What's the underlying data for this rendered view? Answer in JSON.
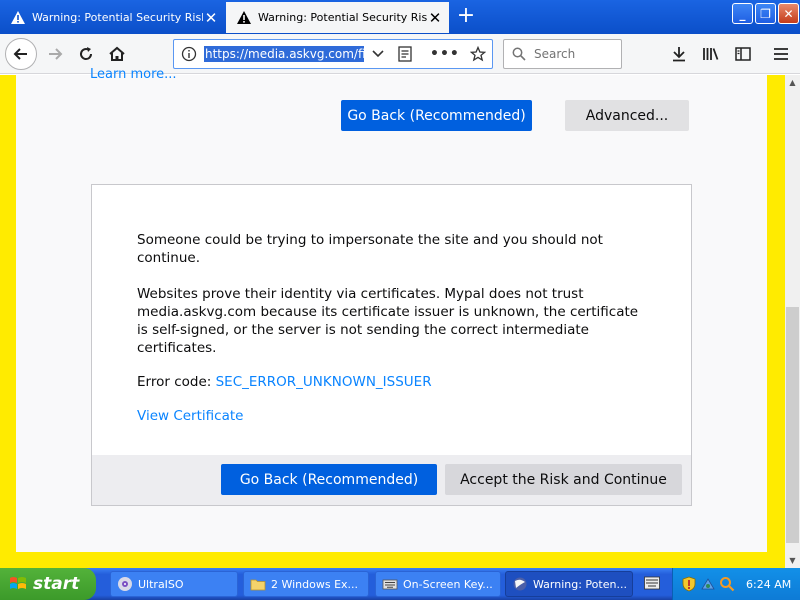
{
  "tabs": [
    {
      "title": "Warning: Potential Security Risk Ahead",
      "active": false
    },
    {
      "title": "Warning: Potential Security Risk Ahead",
      "active": true
    }
  ],
  "window_controls": {
    "minimize": "_",
    "maximize": "❐",
    "close": "✕"
  },
  "toolbar": {
    "url": "https://media.askvg.com/files",
    "search_placeholder": "Search"
  },
  "page": {
    "learn_more": "Learn more...",
    "go_back_label": "Go Back (Recommended)",
    "advanced_label": "Advanced...",
    "advanced_panel": {
      "paragraph1": "Someone could be trying to impersonate the site and you should not continue.",
      "paragraph2": "Websites prove their identity via certificates. Mypal does not trust media.askvg.com because its certificate issuer is unknown, the certificate is self-signed, or the server is not sending the correct intermediate certificates.",
      "error_code_label": "Error code: ",
      "error_code": "SEC_ERROR_UNKNOWN_ISSUER",
      "view_certificate": "View Certificate",
      "go_back_label": "Go Back (Recommended)",
      "accept_label": "Accept the Risk and Continue"
    }
  },
  "taskbar": {
    "start_label": "start",
    "tasks": [
      {
        "label": "UltraISO",
        "icon": "ultraiso-icon"
      },
      {
        "label": "2 Windows Ex...",
        "icon": "folder-icon"
      },
      {
        "label": "On-Screen Key...",
        "icon": "keyboard-icon"
      },
      {
        "label": "Warning: Poten...",
        "icon": "browser-icon",
        "active": true
      }
    ],
    "clock": "6:24 AM"
  },
  "colors": {
    "accent_blue": "#0060df",
    "link_blue": "#0a84ff",
    "frame_yellow": "#ffeb00",
    "xp_blue": "#245edb",
    "start_green": "#3c9a2a"
  }
}
